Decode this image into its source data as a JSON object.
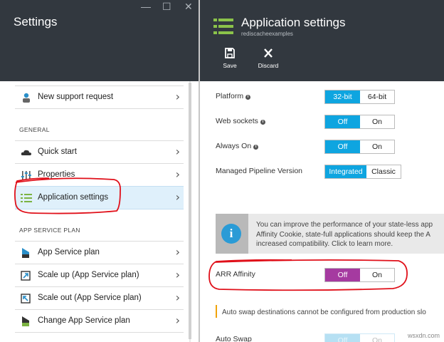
{
  "window": {
    "title": "Settings",
    "minimize_glyph": "—",
    "maximize_glyph": "☐",
    "close_glyph": "✕"
  },
  "left": {
    "support_item": {
      "label": "New support request",
      "icon": "support-person-icon"
    },
    "general_header": "GENERAL",
    "general_items": [
      {
        "label": "Quick start",
        "icon": "cloud-icon"
      },
      {
        "label": "Properties",
        "icon": "sliders-icon"
      },
      {
        "label": "Application settings",
        "icon": "list-settings-icon",
        "selected": true
      }
    ],
    "plan_header": "APP SERVICE PLAN",
    "plan_items": [
      {
        "label": "App Service plan",
        "icon": "app-service-plan-icon"
      },
      {
        "label": "Scale up (App Service plan)",
        "icon": "scale-up-icon"
      },
      {
        "label": "Scale out (App Service plan)",
        "icon": "scale-out-icon"
      },
      {
        "label": "Change App Service plan",
        "icon": "change-plan-icon"
      }
    ],
    "chevron": "›"
  },
  "right": {
    "title": "Application settings",
    "subtitle": "rediscacheexamples",
    "commands": [
      {
        "label": "Save",
        "icon": "save-icon"
      },
      {
        "label": "Discard",
        "icon": "discard-icon"
      }
    ],
    "platform": {
      "label": "Platform",
      "options": [
        "32-bit",
        "64-bit"
      ],
      "selected": "32-bit"
    },
    "web_sockets": {
      "label": "Web sockets",
      "options": [
        "Off",
        "On"
      ],
      "selected": "Off"
    },
    "always_on": {
      "label": "Always On",
      "options": [
        "Off",
        "On"
      ],
      "selected": "Off"
    },
    "pipeline": {
      "label": "Managed Pipeline Version",
      "options": [
        "Integrated",
        "Classic"
      ],
      "selected": "Integrated"
    },
    "info_lines": [
      "You can improve the performance of your state-less app",
      "Affinity Cookie, state-full applications should keep the A",
      "increased compatibility. Click to learn more."
    ],
    "arr_affinity": {
      "label": "ARR Affinity",
      "options": [
        "Off",
        "On"
      ],
      "selected": "Off"
    },
    "auto_swap_warning": "Auto swap destinations cannot be configured from production slo",
    "auto_swap": {
      "label": "Auto Swap",
      "options": [
        "Off",
        "On"
      ],
      "selected": "Off"
    }
  },
  "colors": {
    "header_bg": "#32383f",
    "toggle_on": "#0ea5e0",
    "arr_selected": "#a53aa0",
    "annotation_red": "#e0101a",
    "warning": "#f0a30a"
  },
  "watermark": "wsxdn.com"
}
